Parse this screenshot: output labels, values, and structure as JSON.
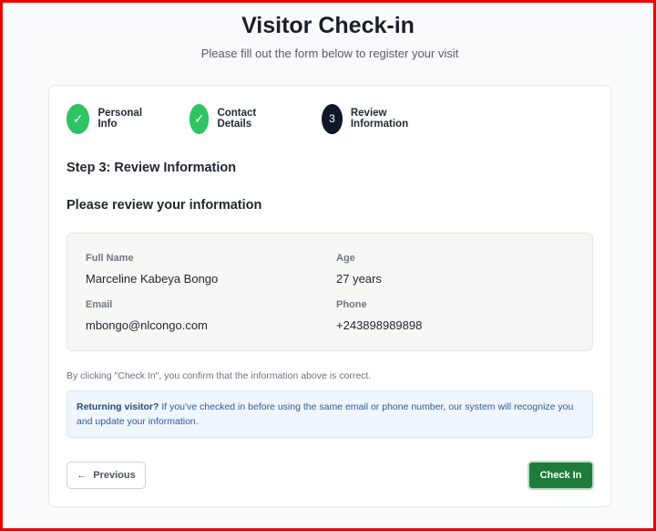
{
  "header": {
    "title": "Visitor Check-in",
    "subtitle": "Please fill out the form below to register your visit"
  },
  "stepper": {
    "steps": [
      {
        "label": "Personal Info",
        "status": "completed",
        "icon": "check-icon"
      },
      {
        "label": "Contact Details",
        "status": "completed",
        "icon": "check-icon"
      },
      {
        "label": "Review Information",
        "status": "active",
        "number": "3"
      }
    ]
  },
  "form": {
    "step_title": "Step 3: Review Information",
    "review_heading": "Please review your information",
    "fields": {
      "full_name": {
        "label": "Full Name",
        "value": "Marceline Kabeya Bongo"
      },
      "age": {
        "label": "Age",
        "value": "27 years"
      },
      "email": {
        "label": "Email",
        "value": "mbongo@nlcongo.com"
      },
      "phone": {
        "label": "Phone",
        "value": "+243898989898"
      }
    },
    "confirm_note": "By clicking \"Check In\", you confirm that the information above is correct.",
    "notice": {
      "bold": "Returning visitor?",
      "text": " If you've checked in before using the same email or phone number, our system will recognize you and update your information."
    }
  },
  "actions": {
    "previous_label": "Previous",
    "previous_icon": "arrow-left-icon",
    "checkin_label": "Check In"
  },
  "colors": {
    "completed": "#2fc363",
    "active": "#101828",
    "primary_button": "#1e7b3b",
    "notice_bg": "#eff6fe",
    "frame_border": "#ef0000"
  }
}
